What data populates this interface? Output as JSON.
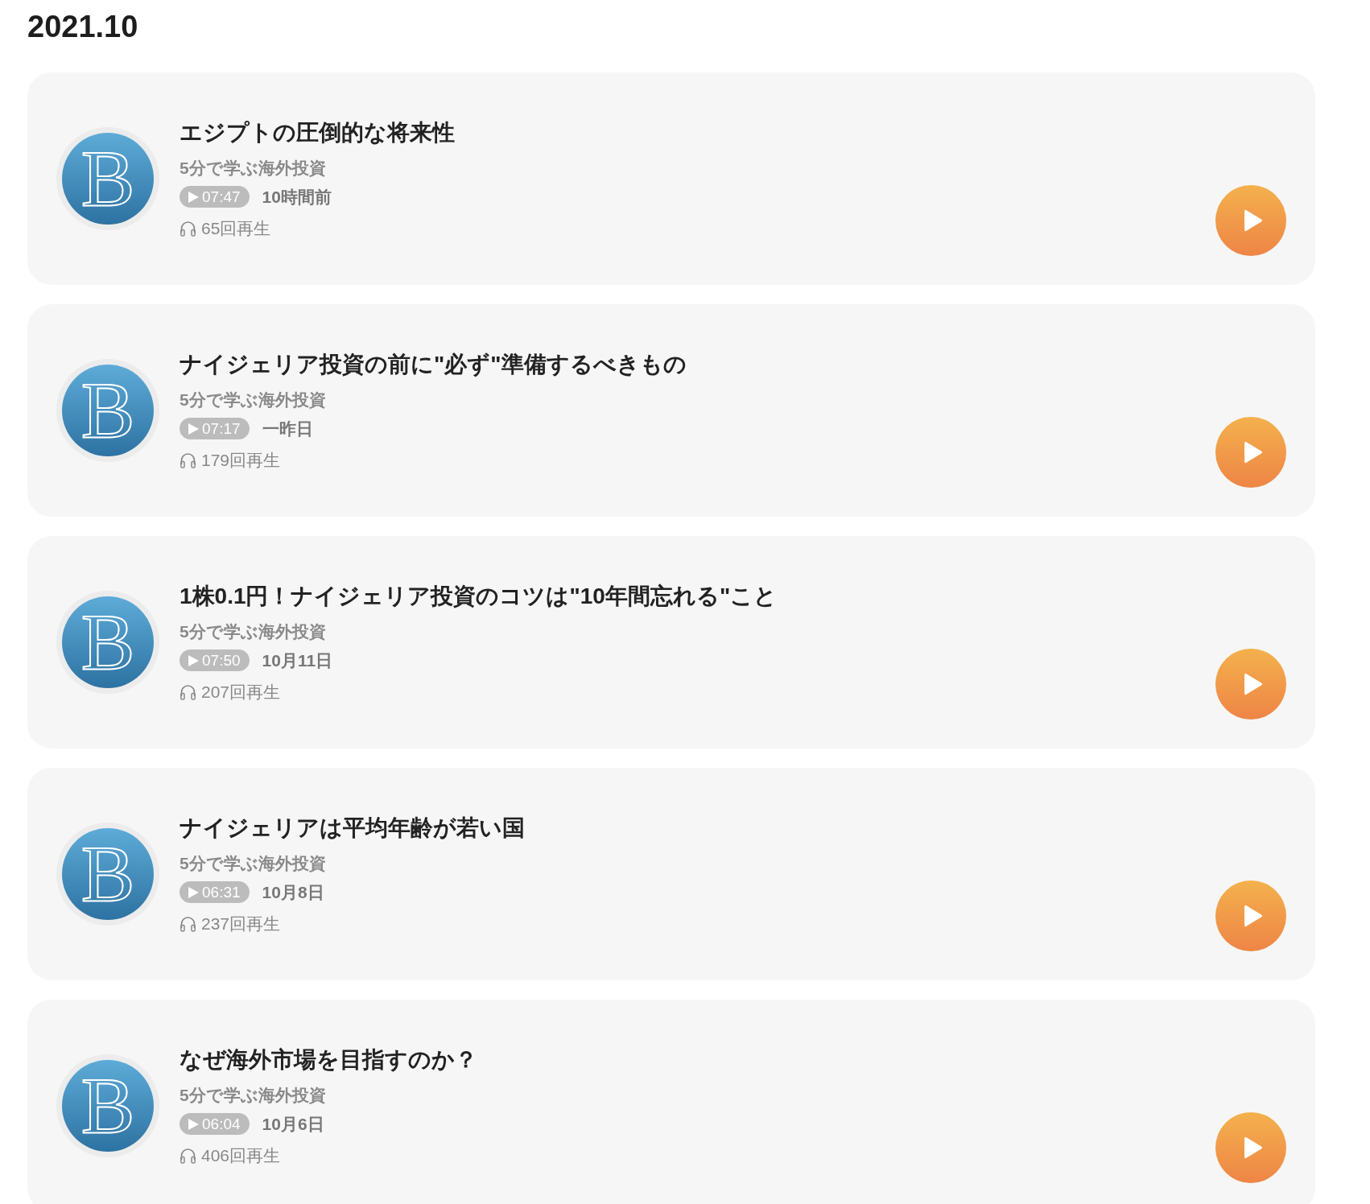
{
  "month_heading": "2021.10",
  "episodes": [
    {
      "artwork_letter": "B",
      "title": "エジプトの圧倒的な将来性",
      "show": "5分で学ぶ海外投資",
      "duration": "07:47",
      "published": "10時間前",
      "plays": "65回再生"
    },
    {
      "artwork_letter": "B",
      "title": "ナイジェリア投資の前に\"必ず\"準備するべきもの",
      "show": "5分で学ぶ海外投資",
      "duration": "07:17",
      "published": "一昨日",
      "plays": "179回再生"
    },
    {
      "artwork_letter": "B",
      "title": "1株0.1円！ナイジェリア投資のコツは\"10年間忘れる\"こと",
      "show": "5分で学ぶ海外投資",
      "duration": "07:50",
      "published": "10月11日",
      "plays": "207回再生"
    },
    {
      "artwork_letter": "B",
      "title": "ナイジェリアは平均年齢が若い国",
      "show": "5分で学ぶ海外投資",
      "duration": "06:31",
      "published": "10月8日",
      "plays": "237回再生"
    },
    {
      "artwork_letter": "B",
      "title": "なぜ海外市場を目指すのか？",
      "show": "5分で学ぶ海外投資",
      "duration": "06:04",
      "published": "10月6日",
      "plays": "406回再生"
    }
  ]
}
